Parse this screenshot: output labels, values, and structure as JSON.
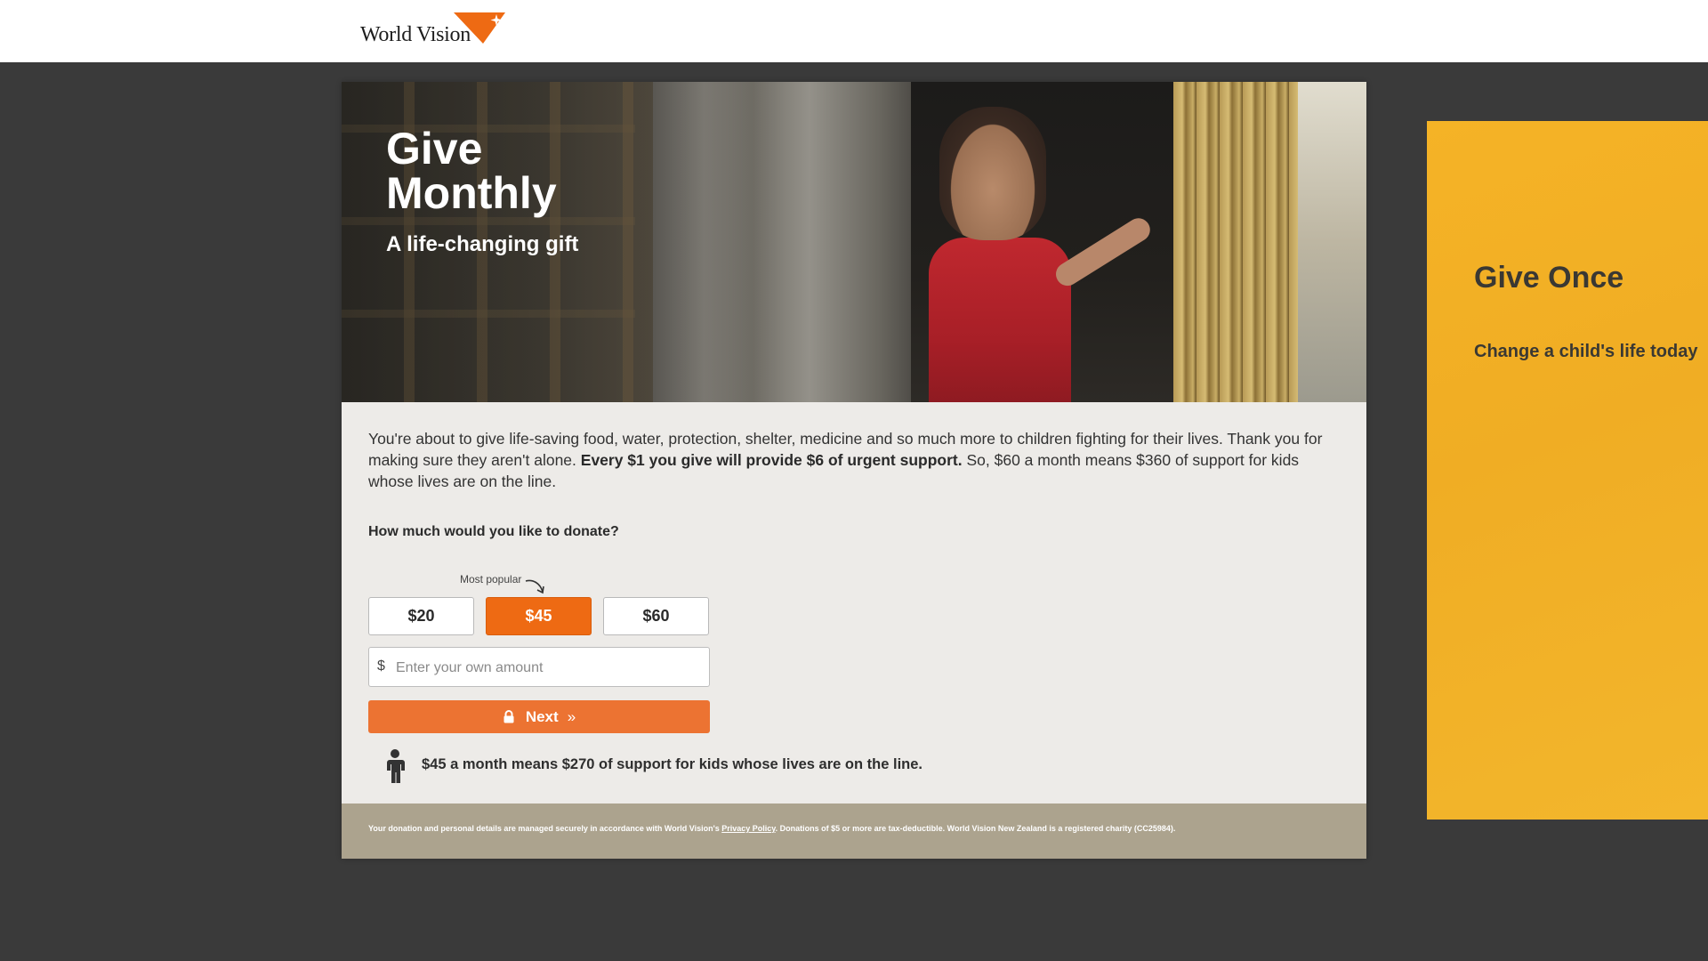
{
  "header": {
    "logo_text": "World Vision",
    "brand_color": "#ee6a13"
  },
  "monthly": {
    "title": "Give Monthly",
    "subtitle": "A life-changing gift",
    "intro_part1": "You're about to give life-saving food, water, protection, shelter, medicine and so much more to children fighting for their lives. Thank you for making sure they aren't alone. ",
    "intro_bold": "Every $1 you give will provide $6 of urgent support.",
    "intro_part2": " So, $60 a month means $360 of support for kids whose lives are on the line.",
    "question": "How much would you like to donate?",
    "popular_label": "Most popular",
    "amounts": [
      {
        "label": "$20",
        "selected": false
      },
      {
        "label": "$45",
        "selected": true
      },
      {
        "label": "$60",
        "selected": false
      }
    ],
    "custom_currency": "$",
    "custom_placeholder": "Enter your own amount",
    "custom_value": "",
    "next_label": "Next",
    "next_icons": [
      "lock-icon",
      "double-chevron-right-icon"
    ],
    "impact_text": "$45 a month means $270 of support for kids whose lives are on the line.",
    "footer_part1": "Your donation and personal details are managed securely in accordance with World Vision's ",
    "footer_link": "Privacy Policy",
    "footer_part2": ". Donations of $5 or more are tax-deductible. World Vision New Zealand is a registered charity (CC25984)."
  },
  "once": {
    "title": "Give Once",
    "subtitle": "Change a child's life today",
    "background_color": "#f5b326"
  },
  "colors": {
    "page_background": "#3a3a3a",
    "selected_amount": "#ee6a13",
    "next_button": "#ec7332",
    "footer": "#aca38e"
  }
}
